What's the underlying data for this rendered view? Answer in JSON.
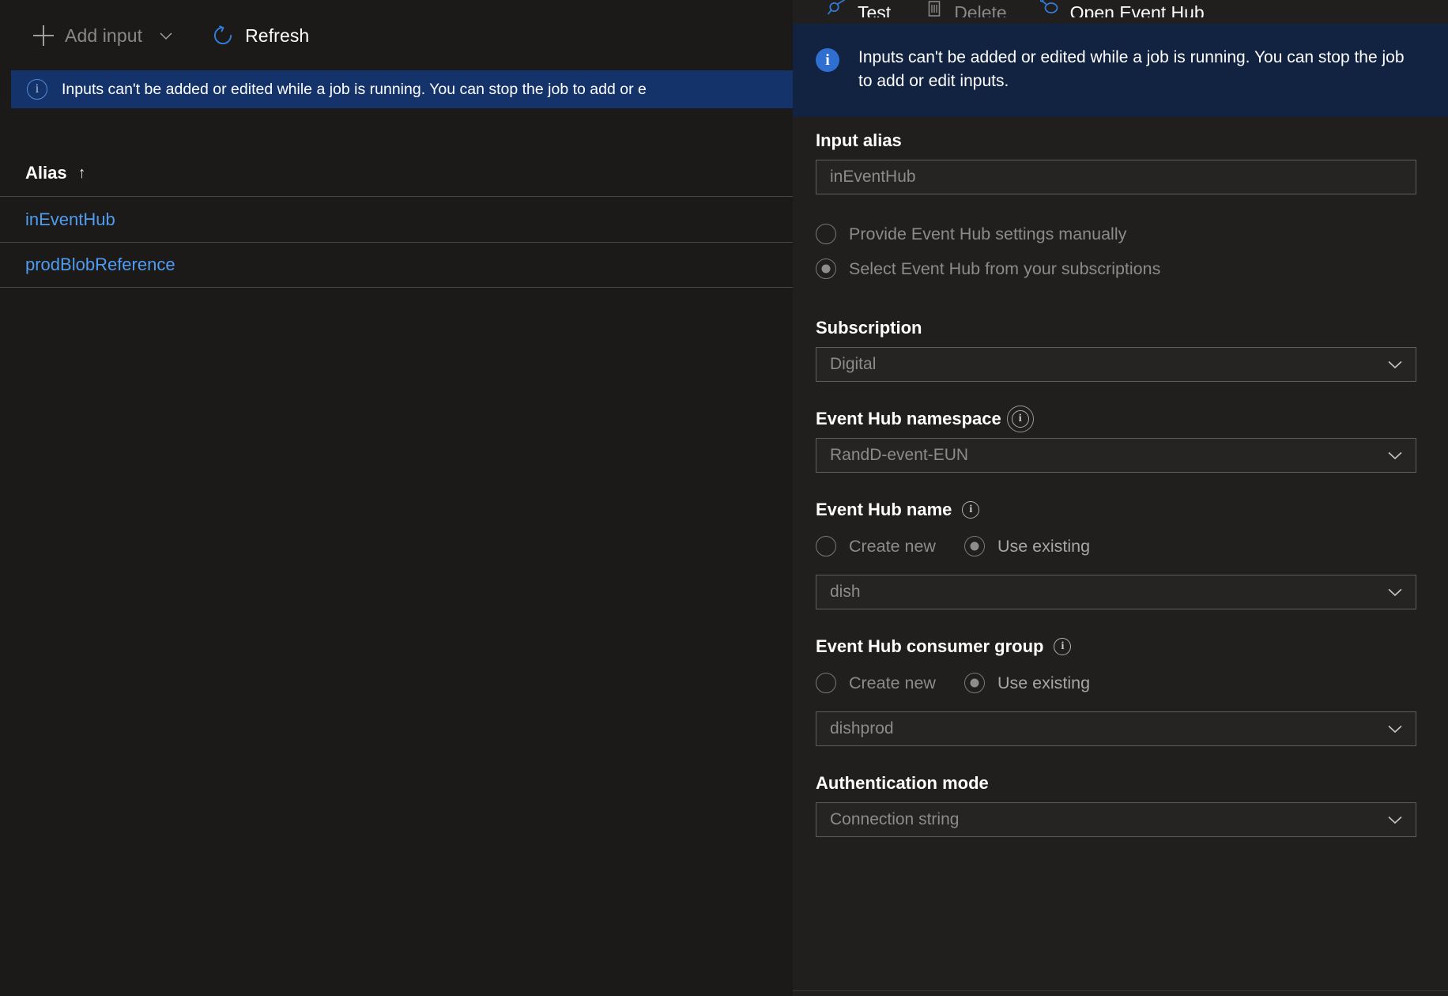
{
  "left": {
    "toolbar": {
      "add_input_label": "Add input",
      "add_input_icon": "plus-icon",
      "add_input_chevron_icon": "chevron-down-icon",
      "refresh_label": "Refresh",
      "refresh_icon": "refresh-circular-arrow-icon"
    },
    "banner": {
      "icon": "info-circle-outline-icon",
      "text": "Inputs can't be added or edited while a job is running. You can stop the job to add or e",
      "background": "#15336b"
    },
    "grid": {
      "column_header": "Alias",
      "sort_indicator": "↑",
      "rows": [
        {
          "alias": "inEventHub"
        },
        {
          "alias": "prodBlobReference"
        }
      ],
      "link_color": "#4f9cf0"
    }
  },
  "right": {
    "toolbar": {
      "test_label": "Test",
      "test_icon": "plug-test-icon",
      "delete_label": "Delete",
      "delete_icon": "trash-can-icon",
      "open_label": "Open Event Hub",
      "open_icon": "event-hub-cloud-icon"
    },
    "banner": {
      "icon": "info-circle-filled-icon",
      "text": "Inputs can't be added or edited while a job is running. You can stop the job to add or edit inputs.",
      "background": "#112340"
    },
    "form": {
      "input_alias": {
        "label": "Input alias",
        "value": "inEventHub"
      },
      "source_mode": {
        "options": [
          {
            "label": "Provide Event Hub settings manually",
            "selected": false
          },
          {
            "label": "Select Event Hub from your subscriptions",
            "selected": true
          }
        ]
      },
      "subscription": {
        "label": "Subscription",
        "value": "Digital",
        "chevron_icon": "chevron-down-icon"
      },
      "namespace": {
        "label": "Event Hub namespace",
        "info_icon": "info-circle-outline-icon",
        "value": "RandD-event-EUN",
        "chevron_icon": "chevron-down-icon"
      },
      "hub_name": {
        "label": "Event Hub name",
        "info_icon": "info-circle-outline-icon",
        "create_new_label": "Create new",
        "use_existing_label": "Use existing",
        "selected": "Use existing",
        "value": "dish",
        "chevron_icon": "chevron-down-icon"
      },
      "consumer_group": {
        "label": "Event Hub consumer group",
        "info_icon": "info-circle-outline-icon",
        "create_new_label": "Create new",
        "use_existing_label": "Use existing",
        "selected": "Use existing",
        "value": "dishprod",
        "chevron_icon": "chevron-down-icon"
      },
      "auth_mode": {
        "label": "Authentication mode",
        "value": "Connection string",
        "chevron_icon": "chevron-down-icon"
      }
    }
  }
}
